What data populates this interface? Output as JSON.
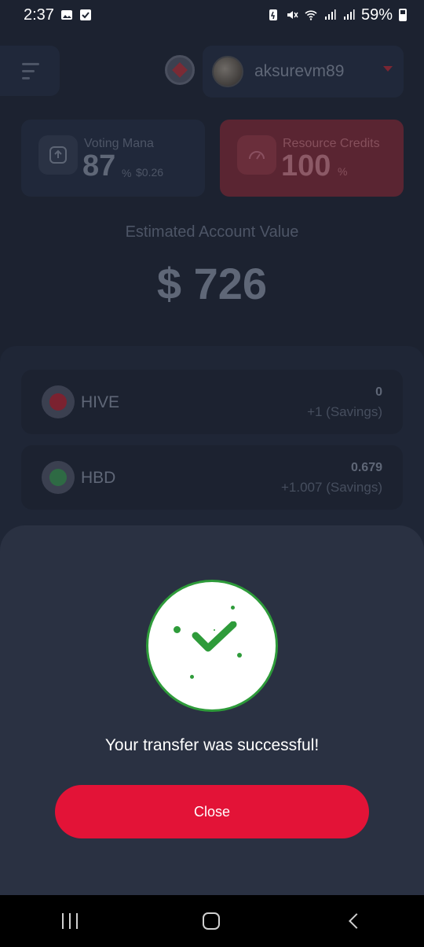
{
  "status_bar": {
    "time": "2:37",
    "battery": "59%"
  },
  "header": {
    "username": "aksurevm89"
  },
  "cards": {
    "voting_mana": {
      "title": "Voting Mana",
      "value": "87",
      "unit": "%",
      "usd": "$0.26"
    },
    "resource_credits": {
      "title": "Resource Credits",
      "value": "100",
      "unit": "%"
    }
  },
  "estimated": {
    "label": "Estimated Account Value",
    "value": "$ 726"
  },
  "tokens": [
    {
      "name": "HIVE",
      "amount": "0",
      "savings": "+1 (Savings)"
    },
    {
      "name": "HBD",
      "amount": "0.679",
      "savings": "+1.007 (Savings)"
    }
  ],
  "modal": {
    "message": "Your transfer was successful!",
    "close_label": "Close"
  },
  "colors": {
    "accent": "#e31337",
    "success": "#2e9b3a",
    "background": "#1c2230",
    "sheet": "#2a3142"
  }
}
